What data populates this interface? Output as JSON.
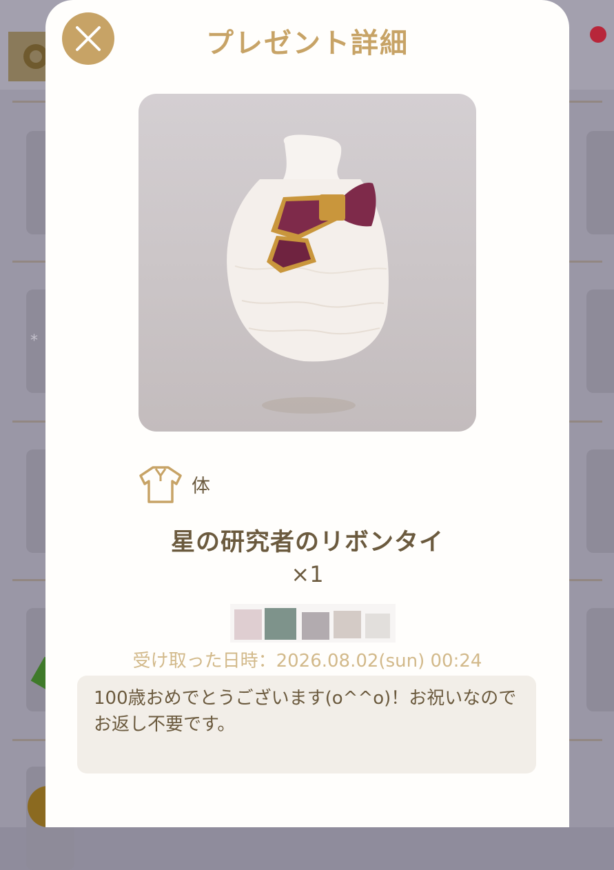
{
  "modal": {
    "title": "プレゼント詳細",
    "close_icon": "close-x-icon"
  },
  "item": {
    "image_description_icon": "ribbon-tie-item",
    "category_icon": "shirt-icon",
    "category_label": "体",
    "name": "星の研究者のリボンタイ",
    "quantity": "×1"
  },
  "received": {
    "label": "受け取った日時：2026.08.02(sun) 00:24"
  },
  "message": {
    "text": "100歳おめでとうございます(o^^o)！お祝いなのでお返し不要です。"
  },
  "colors": {
    "accent_gold": "#c7a366",
    "text_brown": "#6b5a3e",
    "bow_purple": "#7e2a4a",
    "notification_red": "#b8263a"
  }
}
